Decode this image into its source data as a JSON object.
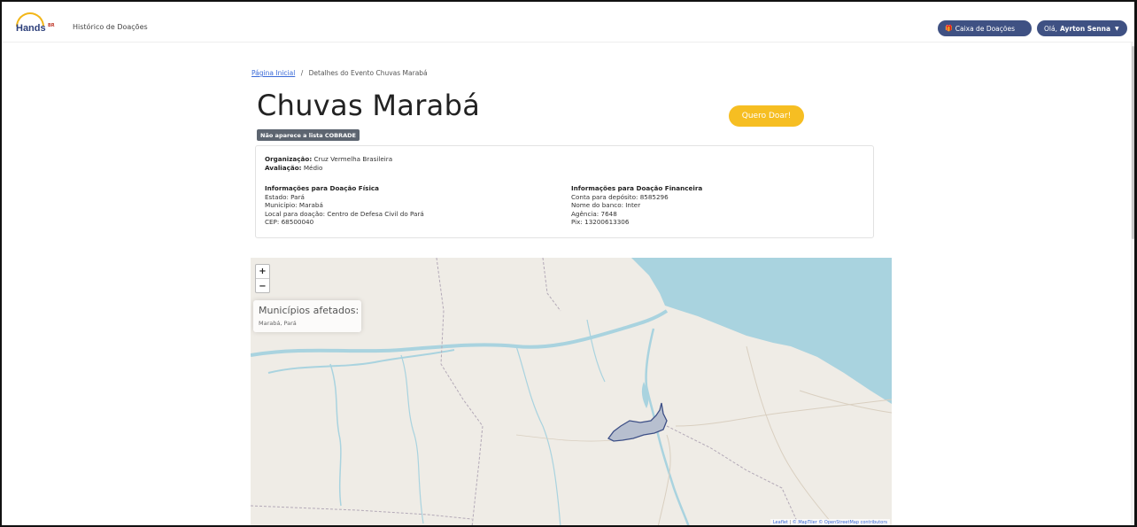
{
  "navbar": {
    "logo_text": "Hands",
    "logo_sup": "BR",
    "history_link": "Histórico de Doações",
    "donation_box": "Caixa de Doações",
    "greeting": "Olá,",
    "user_name": "Ayrton Senna"
  },
  "breadcrumb": {
    "home": "Página Inicial",
    "separator": "/",
    "current": "Detalhes do Evento Chuvas Marabá"
  },
  "event": {
    "title": "Chuvas Marabá",
    "badge": "Não aparece a lista COBRADE",
    "donate_button": "Quero Doar!"
  },
  "details": {
    "org_label": "Organização:",
    "org_value": "Cruz Vermelha Brasileira",
    "rating_label": "Avaliação:",
    "rating_value": "Médio",
    "physical": {
      "heading": "Informações para Doação Física",
      "lines": [
        "Estado: Pará",
        "Município: Marabá",
        "Local para doação: Centro de Defesa Civil do Pará",
        "CEP: 68500040"
      ]
    },
    "financial": {
      "heading": "Informações para Doação Financeira",
      "lines": [
        "Conta para depósito: 8585296",
        "Nome do banco: Inter",
        "Agência: 7648",
        "Pix: 13200613306"
      ]
    }
  },
  "map": {
    "zoom_in": "+",
    "zoom_out": "−",
    "legend_title": "Municípios afetados:",
    "legend_items": "Marabá, Pará",
    "attribution_leaflet": "Leaflet",
    "attribution_rest": "© MapTiler © OpenStreetMap contributors",
    "colors": {
      "land": "#efece6",
      "water": "#a9d3df",
      "highlight": "#b7bfcf",
      "highlight_stroke": "#3d4f86"
    }
  },
  "colors": {
    "accent": "#3f5183",
    "donate": "#f6be22",
    "badge": "#5d6570"
  }
}
